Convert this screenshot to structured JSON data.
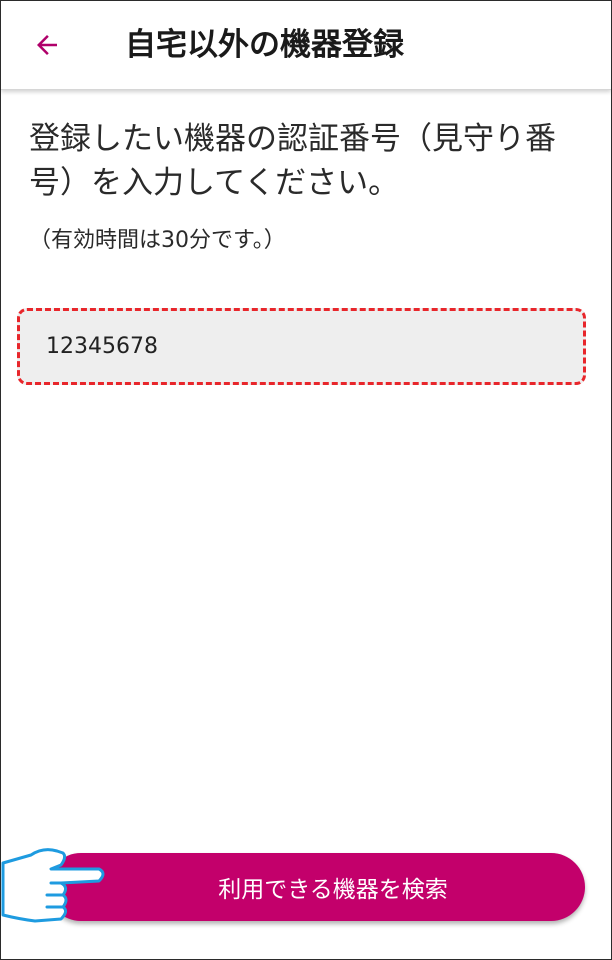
{
  "header": {
    "title": "自宅以外の機器登録",
    "back_icon": "arrow-left-icon",
    "accent_color": "#b0006a"
  },
  "main": {
    "instruction": "登録したい機器の認証番号（見守り番号）を入力してください。",
    "validity_note": "（有効時間は30分です。）",
    "code_input": {
      "value": "12345678",
      "border_color": "#e8262b"
    }
  },
  "footer": {
    "search_button_label": "利用できる機器を検索",
    "button_color": "#c3006b",
    "pointer_icon": "pointing-hand-icon"
  }
}
